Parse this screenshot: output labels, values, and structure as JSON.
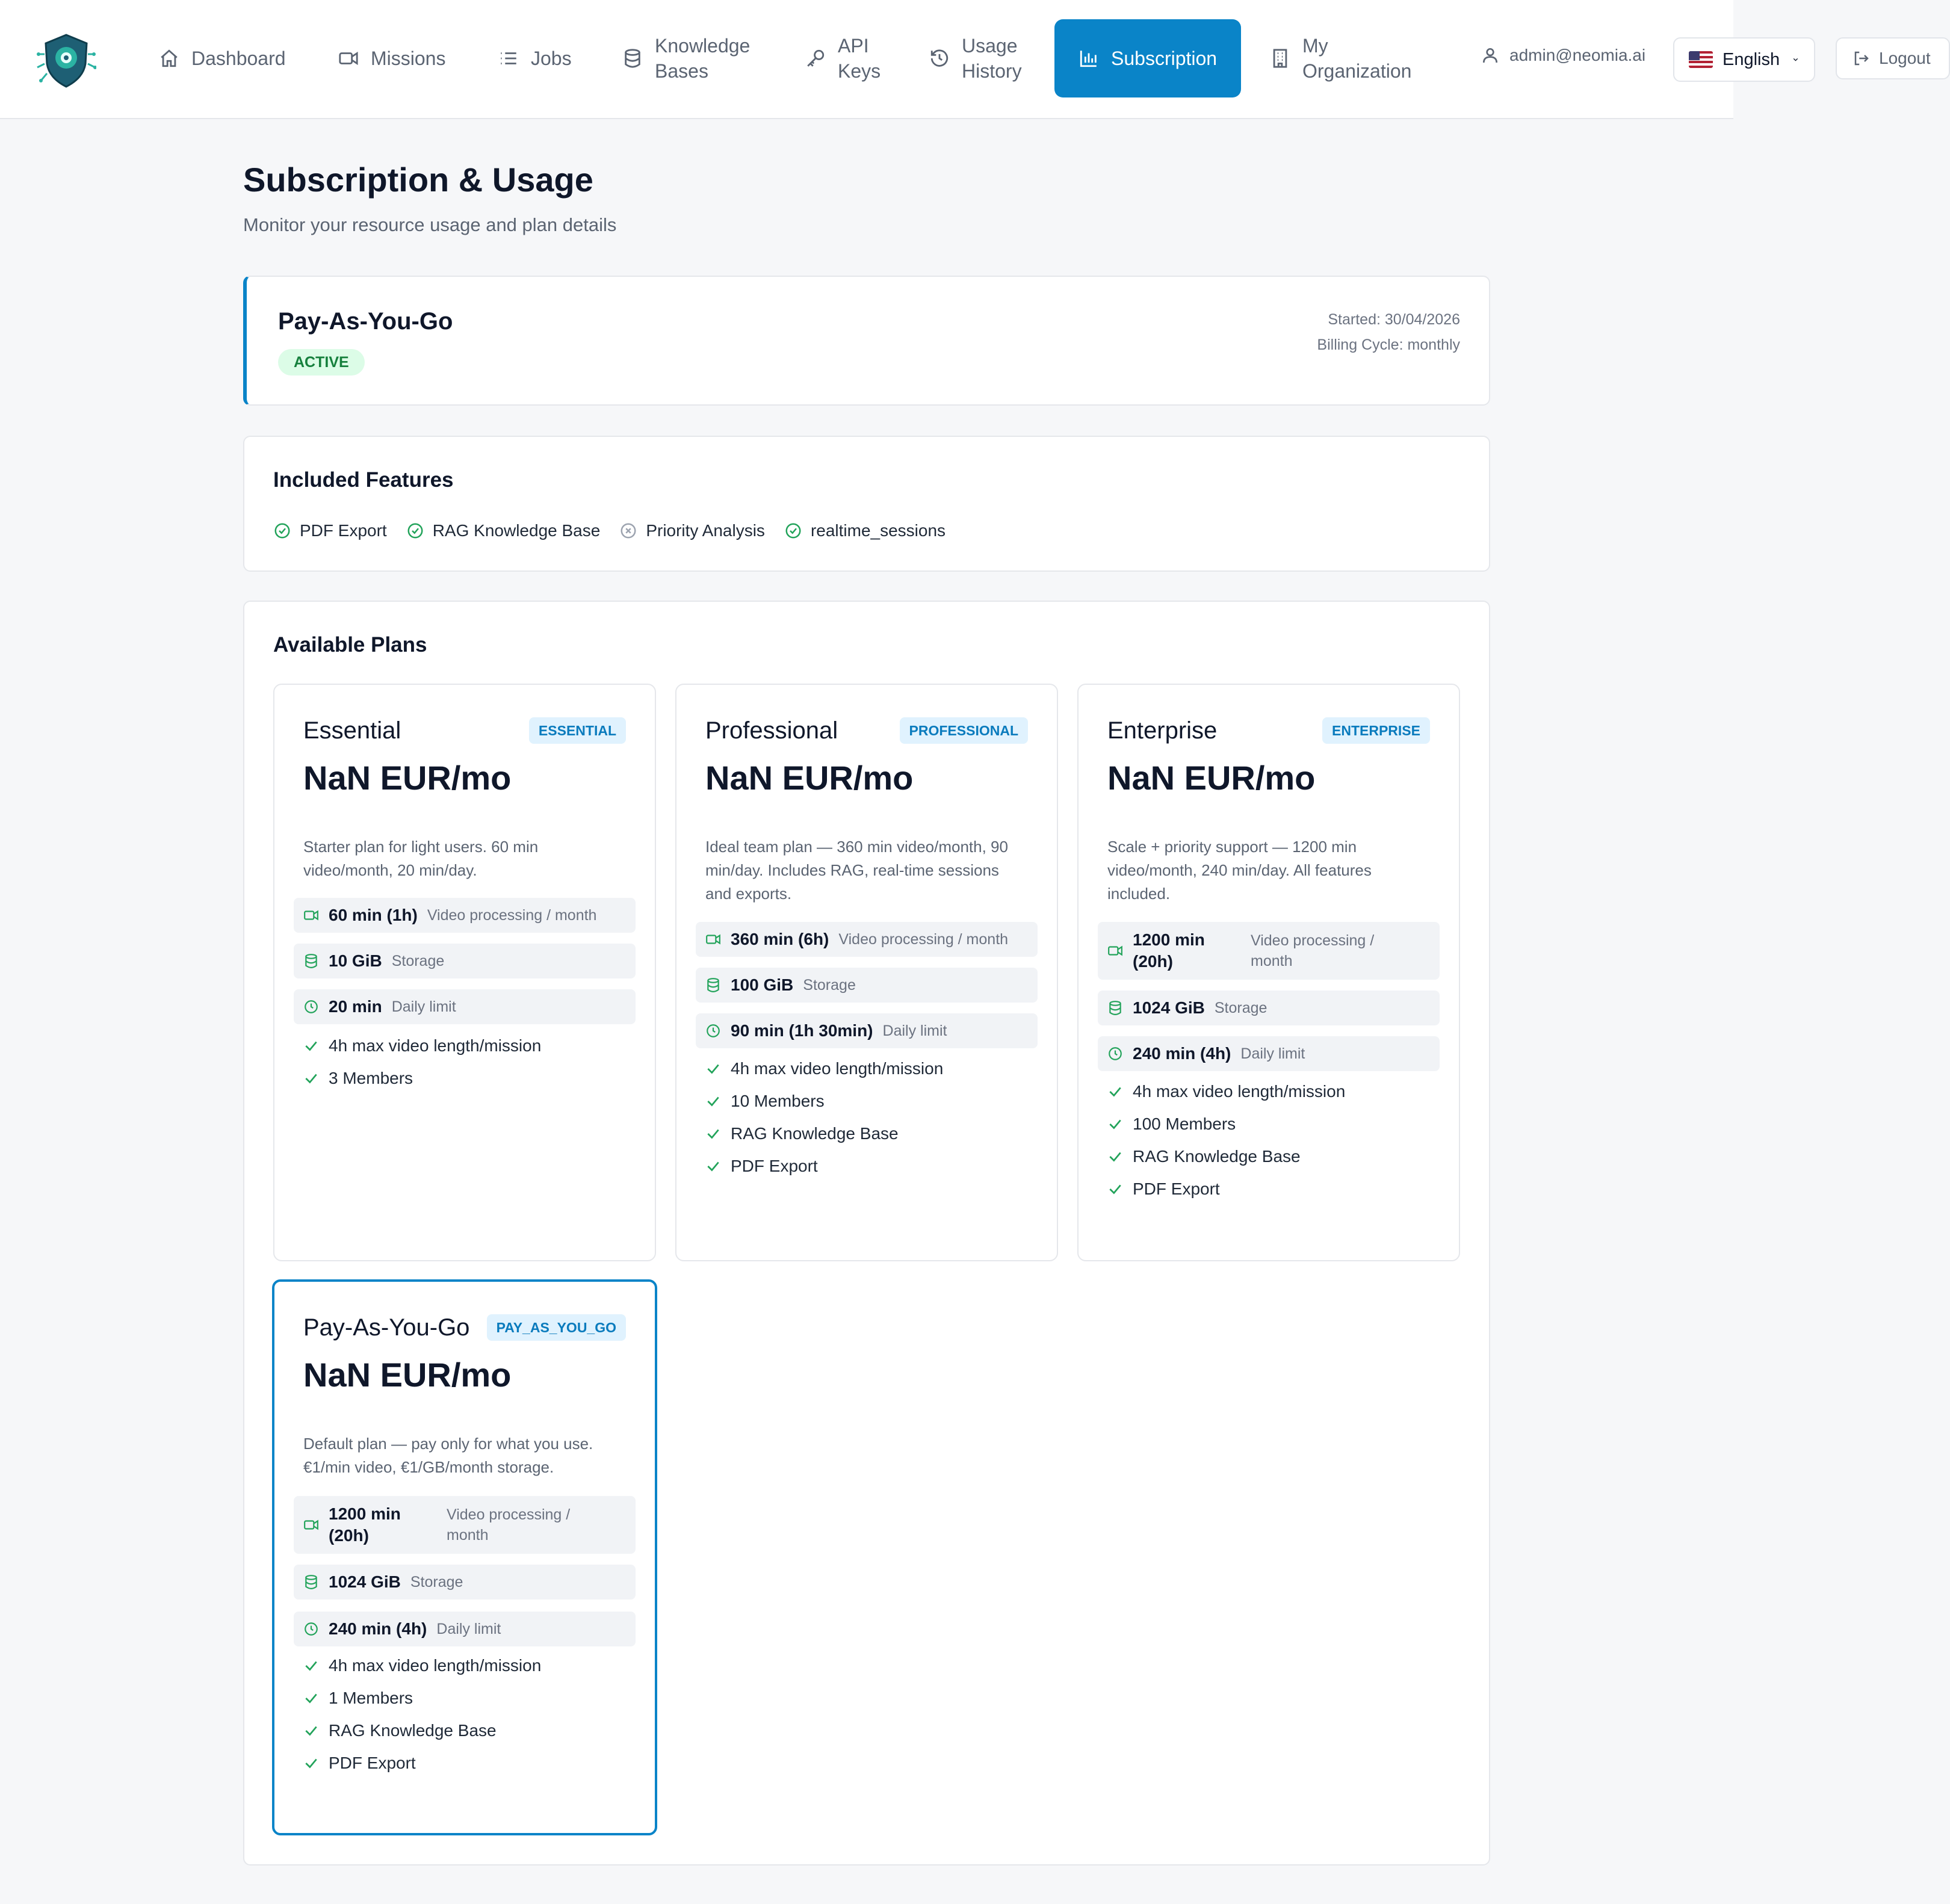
{
  "nav": {
    "items": [
      {
        "label": "Dashboard",
        "icon": "home-icon"
      },
      {
        "label": "Missions",
        "icon": "video-icon"
      },
      {
        "label": "Jobs",
        "icon": "list-icon"
      },
      {
        "label": "Knowledge\nBases",
        "icon": "database-icon"
      },
      {
        "label": "API\nKeys",
        "icon": "key-icon"
      },
      {
        "label": "Usage\nHistory",
        "icon": "history-icon"
      },
      {
        "label": "Subscription",
        "icon": "bar-chart-icon",
        "active": true
      },
      {
        "label": "My\nOrganization",
        "icon": "building-icon"
      }
    ],
    "user_email": "admin@neomia.ai",
    "language": "English",
    "logout": "Logout"
  },
  "page": {
    "title": "Subscription & Usage",
    "subtitle": "Monitor your resource usage and plan details"
  },
  "current_plan": {
    "name": "Pay-As-You-Go",
    "status": "ACTIVE",
    "started": "Started: 30/04/2026",
    "billing_cycle": "Billing Cycle: monthly"
  },
  "included_features": {
    "title": "Included Features",
    "items": [
      {
        "label": "PDF Export",
        "enabled": true
      },
      {
        "label": "RAG Knowledge Base",
        "enabled": true
      },
      {
        "label": "Priority Analysis",
        "enabled": false
      },
      {
        "label": "realtime_sessions",
        "enabled": true
      }
    ]
  },
  "plans": {
    "title": "Available Plans",
    "items": [
      {
        "name": "Essential",
        "tag": "ESSENTIAL",
        "price": "NaN EUR/mo",
        "description": "Starter plan for light users. 60 min video/month, 20 min/day.",
        "video": "60 min (1h)",
        "video_label": "Video processing / month",
        "storage": "10 GiB",
        "storage_label": "Storage",
        "daily": "20 min",
        "daily_label": "Daily limit",
        "bullets": [
          "4h max video length/mission",
          "3 Members"
        ]
      },
      {
        "name": "Professional",
        "tag": "PROFESSIONAL",
        "price": "NaN EUR/mo",
        "description": "Ideal team plan — 360 min video/month, 90 min/day. Includes RAG, real-time sessions and exports.",
        "video": "360 min (6h)",
        "video_label": "Video processing / month",
        "storage": "100 GiB",
        "storage_label": "Storage",
        "daily": "90 min (1h 30min)",
        "daily_label": "Daily limit",
        "bullets": [
          "4h max video length/mission",
          "10 Members",
          "RAG Knowledge Base",
          "PDF Export"
        ]
      },
      {
        "name": "Enterprise",
        "tag": "ENTERPRISE",
        "price": "NaN EUR/mo",
        "description": "Scale + priority support — 1200 min video/month, 240 min/day. All features included.",
        "video": "1200 min (20h)",
        "video_label": "Video processing / month",
        "storage": "1024 GiB",
        "storage_label": "Storage",
        "daily": "240 min (4h)",
        "daily_label": "Daily limit",
        "bullets": [
          "4h max video length/mission",
          "100 Members",
          "RAG Knowledge Base",
          "PDF Export"
        ]
      },
      {
        "name": "Pay-As-You-Go",
        "tag": "PAY_AS_YOU_GO",
        "price": "NaN EUR/mo",
        "description": "Default plan — pay only for what you use. €1/min video, €1/GB/month storage.",
        "video": "1200 min (20h)",
        "video_label": "Video processing / month",
        "storage": "1024 GiB",
        "storage_label": "Storage",
        "daily": "240 min (4h)",
        "daily_label": "Daily limit",
        "bullets": [
          "4h max video length/mission",
          "1 Members",
          "RAG Knowledge Base",
          "PDF Export"
        ]
      }
    ]
  },
  "colors": {
    "accent": "#0a84c8",
    "success": "#22a35a",
    "active_badge_bg": "#dcfce7"
  }
}
